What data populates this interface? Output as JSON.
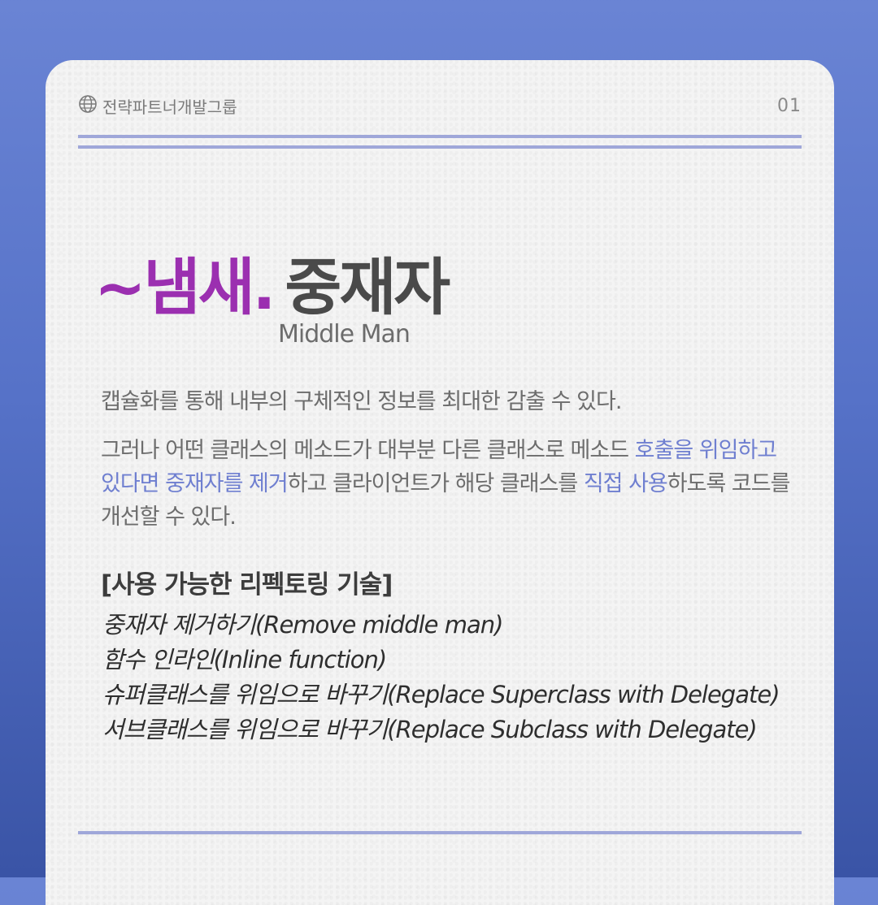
{
  "header": {
    "brand": "전략파트너개발그룹",
    "page_number": "01"
  },
  "title": {
    "accent": "~냄새.",
    "main": "중재자",
    "subtitle": "Middle Man"
  },
  "paragraph1": "캡슐화를 통해 내부의 구체적인 정보를 최대한 감출 수 있다.",
  "paragraph2": {
    "part1": "그러나 어떤 클래스의 메소드가 대부분 다른 클래스로 메소드 ",
    "highlight1": "호출을 위임하고 있다면 중재자를 제거",
    "part2": "하고 클라이언트가 해당 클래스를 ",
    "highlight2": "직접 사용",
    "part3": "하도록 코드를 개선할 수 있다."
  },
  "section_title": "[사용 가능한 리펙토링 기술]",
  "techniques": [
    "중재자 제거하기(Remove middle man)",
    "함수 인라인(Inline function)",
    "슈퍼클래스를 위임으로 바꾸기(Replace Superclass with Delegate)",
    "서브클래스를 위임으로 바꾸기(Replace Subclass with Delegate)"
  ],
  "colors": {
    "accent": "#9b2fb0",
    "highlight": "#6f7fd0",
    "rule": "#9fa7d9",
    "background": "#5a74c8"
  },
  "icons": {
    "brand_icon": "globe-icon"
  }
}
